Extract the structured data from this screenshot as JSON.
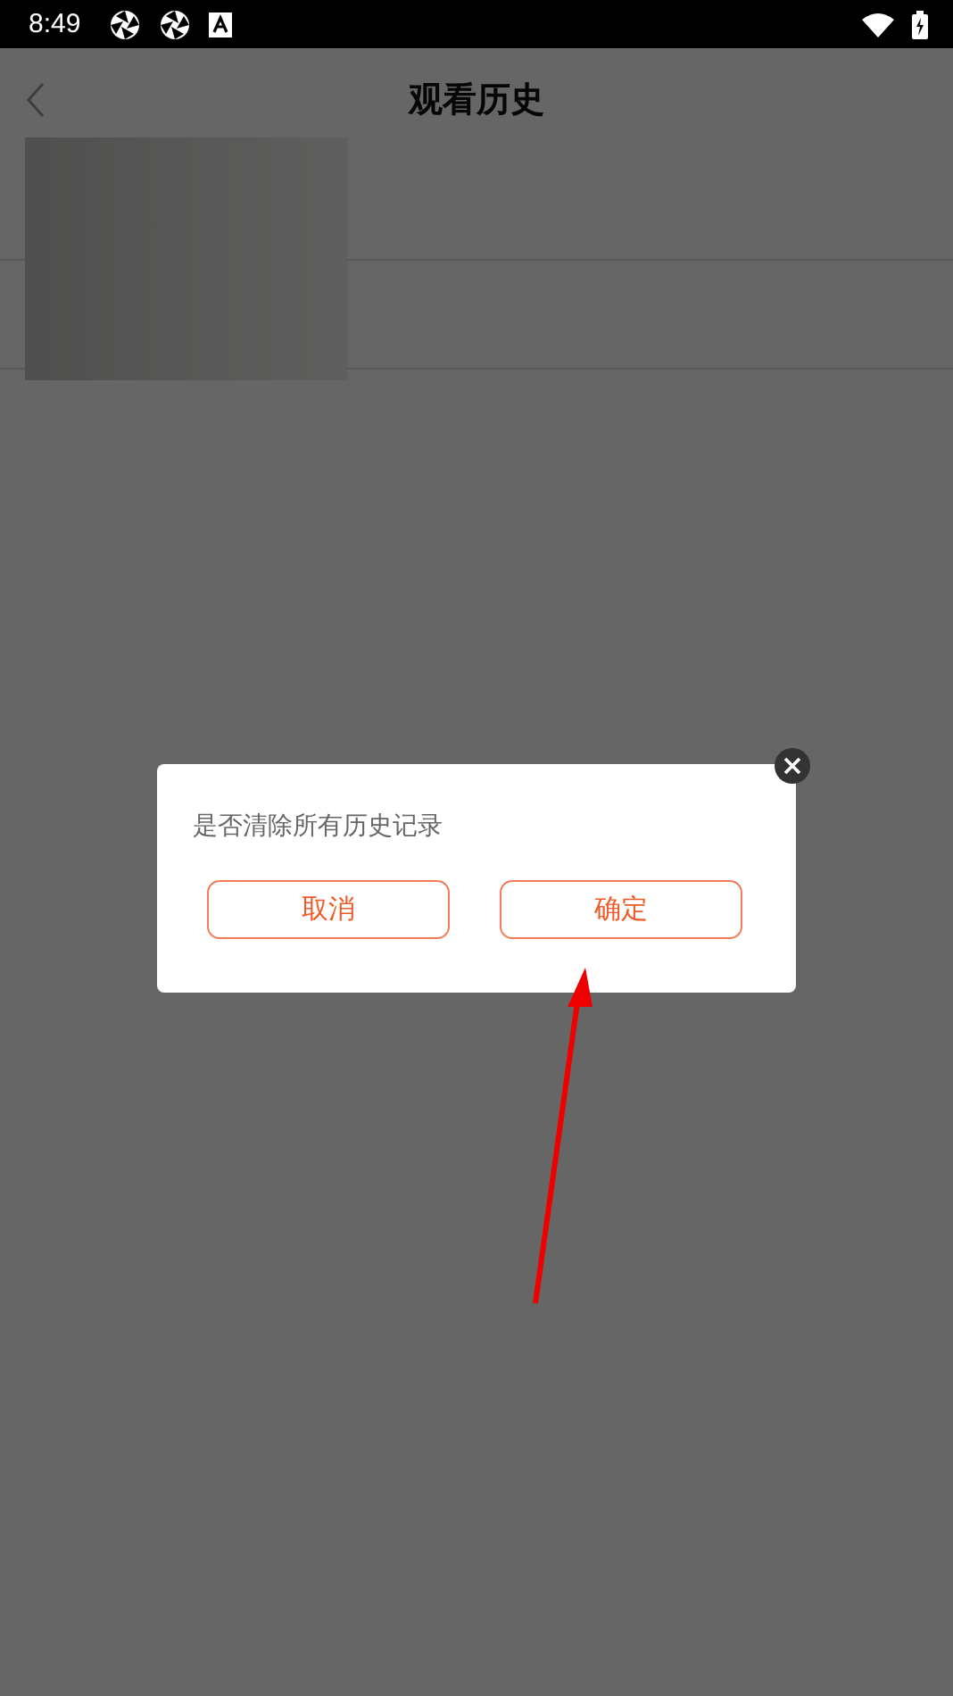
{
  "status_bar": {
    "time": "8:49"
  },
  "header": {
    "title": "观看历史"
  },
  "dialog": {
    "message": "是否清除所有历史记录",
    "buttons": [
      {
        "label": "取消"
      },
      {
        "label": "确定"
      }
    ]
  }
}
